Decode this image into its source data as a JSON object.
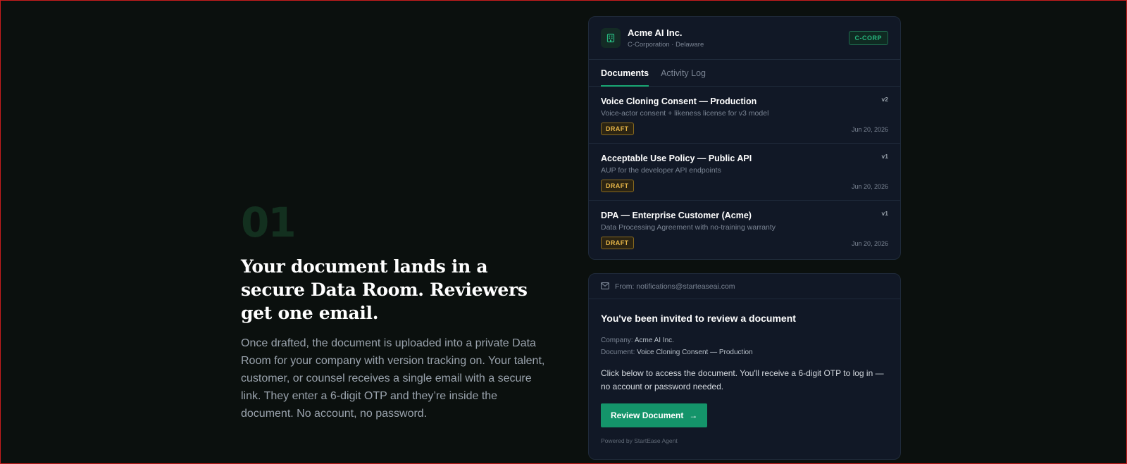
{
  "section": {
    "step": "01",
    "headline": "Your document lands in a secure Data Room. Reviewers get one email.",
    "body": "Once drafted, the document is uploaded into a private Data Room for your company with version tracking on. Your talent, customer, or counsel receives a single email with a secure link. They enter a 6-digit OTP and they’re inside the document. No account, no password."
  },
  "data_room": {
    "company_name": "Acme AI Inc.",
    "company_sub": "C-Corporation · Delaware",
    "entity_badge": "C-CORP",
    "tabs": [
      {
        "label": "Documents",
        "active": true
      },
      {
        "label": "Activity Log",
        "active": false
      }
    ],
    "documents": [
      {
        "title": "Voice Cloning Consent — Production",
        "description": "Voice-actor consent + likeness license for v3 model",
        "version": "v2",
        "status": "DRAFT",
        "date": "Jun 20, 2026"
      },
      {
        "title": "Acceptable Use Policy — Public API",
        "description": "AUP for the developer API endpoints",
        "version": "v1",
        "status": "DRAFT",
        "date": "Jun 20, 2026"
      },
      {
        "title": "DPA — Enterprise Customer (Acme)",
        "description": "Data Processing Agreement with no-training warranty",
        "version": "v1",
        "status": "DRAFT",
        "date": "Jun 20, 2026"
      }
    ]
  },
  "email": {
    "from": "From: notifications@starteaseai.com",
    "title": "You've been invited to review a document",
    "company_label": "Company:",
    "company_value": "Acme AI Inc.",
    "document_label": "Document:",
    "document_value": "Voice Cloning Consent — Production",
    "body": "Click below to access the document. You'll receive a 6-digit OTP to log in — no account or password needed.",
    "button_label": "Review Document",
    "button_arrow": "→",
    "footer": "Powered by StartEase Agent"
  },
  "colors": {
    "background": "#0b100e",
    "accent": "#14946a",
    "draft": "#e6b547"
  }
}
